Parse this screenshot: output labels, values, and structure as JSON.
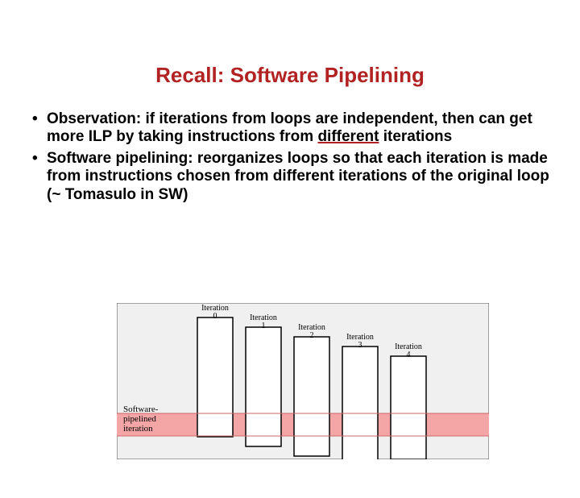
{
  "title": "Recall: Software Pipelining",
  "bullet1_a": "Observation: if iterations from loops are independent, then can get more ILP by taking instructions from ",
  "bullet1_underline": "different",
  "bullet1_b": " iterations",
  "bullet2": "Software pipelining: reorganizes loops so that each iteration is made from instructions chosen from different iterations of the original loop (~ Tomasulo in SW)",
  "diagram": {
    "side_label_a": "Software-",
    "side_label_b": "pipelined",
    "side_label_c": "iteration",
    "iterations": [
      {
        "label_a": "Iteration",
        "label_b": "0"
      },
      {
        "label_a": "Iteration",
        "label_b": "1"
      },
      {
        "label_a": "Iteration",
        "label_b": "2"
      },
      {
        "label_a": "Iteration",
        "label_b": "3"
      },
      {
        "label_a": "Iteration",
        "label_b": "4"
      }
    ]
  }
}
